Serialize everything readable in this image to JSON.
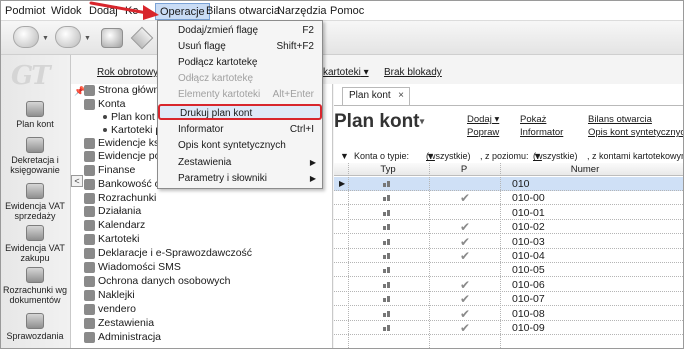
{
  "menubar": {
    "items": [
      "Podmiot",
      "Widok",
      "Dodaj",
      "Ko",
      "Operacje",
      "Bilans otwarcia",
      "Narzędzia",
      "Pomoc"
    ],
    "active": "Operacje"
  },
  "toolbar": {
    "icons": [
      "back-icon",
      "forward-icon",
      "print-icon",
      "tag-icon"
    ]
  },
  "sidebar": {
    "logo": "GT",
    "items": [
      {
        "label": "Plan kont",
        "icon": "coins-icon"
      },
      {
        "label": "Dekretacja i księgowanie",
        "icon": "coins-icon"
      },
      {
        "label": "Ewidencja VAT sprzedaży",
        "icon": "coins-icon"
      },
      {
        "label": "Ewidencja VAT zakupu",
        "icon": "coins-icon"
      },
      {
        "label": "Rozrachunki wg dokumentów",
        "icon": "coins-icon"
      },
      {
        "label": "Sprawozdania",
        "icon": "coins-icon"
      }
    ]
  },
  "toplinks": {
    "rok": "Rok obrotowy :",
    "kartoteki": "kartoteki",
    "blokady": "Brak blokady"
  },
  "tree": {
    "items": [
      {
        "label": "Strona główna",
        "sub": false
      },
      {
        "label": "Konta",
        "sub": false
      },
      {
        "label": "Plan kont",
        "sub": true
      },
      {
        "label": "Kartoteki p",
        "sub": true
      },
      {
        "label": "Ewidencje ksi",
        "sub": false
      },
      {
        "label": "Ewidencje poz",
        "sub": false
      },
      {
        "label": "Finanse",
        "sub": false
      },
      {
        "label": "Bankowość on-line",
        "sub": false
      },
      {
        "label": "Rozrachunki",
        "sub": false
      },
      {
        "label": "Działania",
        "sub": false
      },
      {
        "label": "Kalendarz",
        "sub": false
      },
      {
        "label": "Kartoteki",
        "sub": false
      },
      {
        "label": "Deklaracje i e-Sprawozdawczość",
        "sub": false
      },
      {
        "label": "Wiadomości SMS",
        "sub": false
      },
      {
        "label": "Ochrona danych osobowych",
        "sub": false
      },
      {
        "label": "Naklejki",
        "sub": false
      },
      {
        "label": "vendero",
        "sub": false
      },
      {
        "label": "Zestawienia",
        "sub": false
      },
      {
        "label": "Administracja",
        "sub": false
      }
    ]
  },
  "main": {
    "tab_label": "Plan kont",
    "tab_close": "×",
    "title": "Plan kont",
    "title_caret": "▾",
    "actions": {
      "dodaj": "Dodaj",
      "popraw": "Popraw",
      "pokaz": "Pokaż",
      "informator": "Informator",
      "bilans": "Bilans otwarcia",
      "opis": "Opis kont syntetycznych"
    },
    "filters": {
      "konta_label": "Konta o typie:",
      "konta_value": "(wszystkie)",
      "poziom_label": ", z poziomu:",
      "poziom_value": "(wszystkie)",
      "kontami_label": ", z kontami kartotekowymi"
    },
    "grid": {
      "columns": [
        "Typ",
        "P",
        "Numer"
      ],
      "rows": [
        {
          "numer": "010",
          "checked": false,
          "selected": true
        },
        {
          "numer": "010-00",
          "checked": true,
          "selected": false
        },
        {
          "numer": "010-01",
          "checked": false,
          "selected": false
        },
        {
          "numer": "010-02",
          "checked": true,
          "selected": false
        },
        {
          "numer": "010-03",
          "checked": true,
          "selected": false
        },
        {
          "numer": "010-04",
          "checked": true,
          "selected": false
        },
        {
          "numer": "010-05",
          "checked": false,
          "selected": false
        },
        {
          "numer": "010-06",
          "checked": true,
          "selected": false
        },
        {
          "numer": "010-07",
          "checked": true,
          "selected": false
        },
        {
          "numer": "010-08",
          "checked": true,
          "selected": false
        },
        {
          "numer": "010-09",
          "checked": true,
          "selected": false
        }
      ]
    }
  },
  "dropdown": {
    "items": [
      {
        "label": "Dodaj/zmień flagę",
        "shortcut": "F2",
        "disabled": false,
        "submenu": false
      },
      {
        "label": "Usuń flagę",
        "shortcut": "Shift+F2",
        "disabled": false,
        "submenu": false
      },
      {
        "label": "Podłącz kartotekę",
        "shortcut": "",
        "disabled": false,
        "submenu": false
      },
      {
        "label": "Odłącz kartotekę",
        "shortcut": "",
        "disabled": true,
        "submenu": false
      },
      {
        "label": "Elementy kartoteki",
        "shortcut": "Alt+Enter",
        "disabled": true,
        "submenu": false
      },
      {
        "label": "Drukuj plan kont",
        "shortcut": "",
        "disabled": false,
        "submenu": false,
        "highlighted": true
      },
      {
        "label": "Informator",
        "shortcut": "Ctrl+I",
        "disabled": false,
        "submenu": false
      },
      {
        "label": "Opis kont syntetycznych",
        "shortcut": "",
        "disabled": false,
        "submenu": false
      },
      {
        "label": "Zestawienia",
        "shortcut": "",
        "disabled": false,
        "submenu": true
      },
      {
        "label": "Parametry i słowniki",
        "shortcut": "",
        "disabled": false,
        "submenu": true
      }
    ]
  },
  "colors": {
    "highlight_border": "#d8262d",
    "menu_active": "#c9dcf5",
    "selected_row": "#cfe0f6",
    "annotation_arrow": "#d8262d"
  }
}
